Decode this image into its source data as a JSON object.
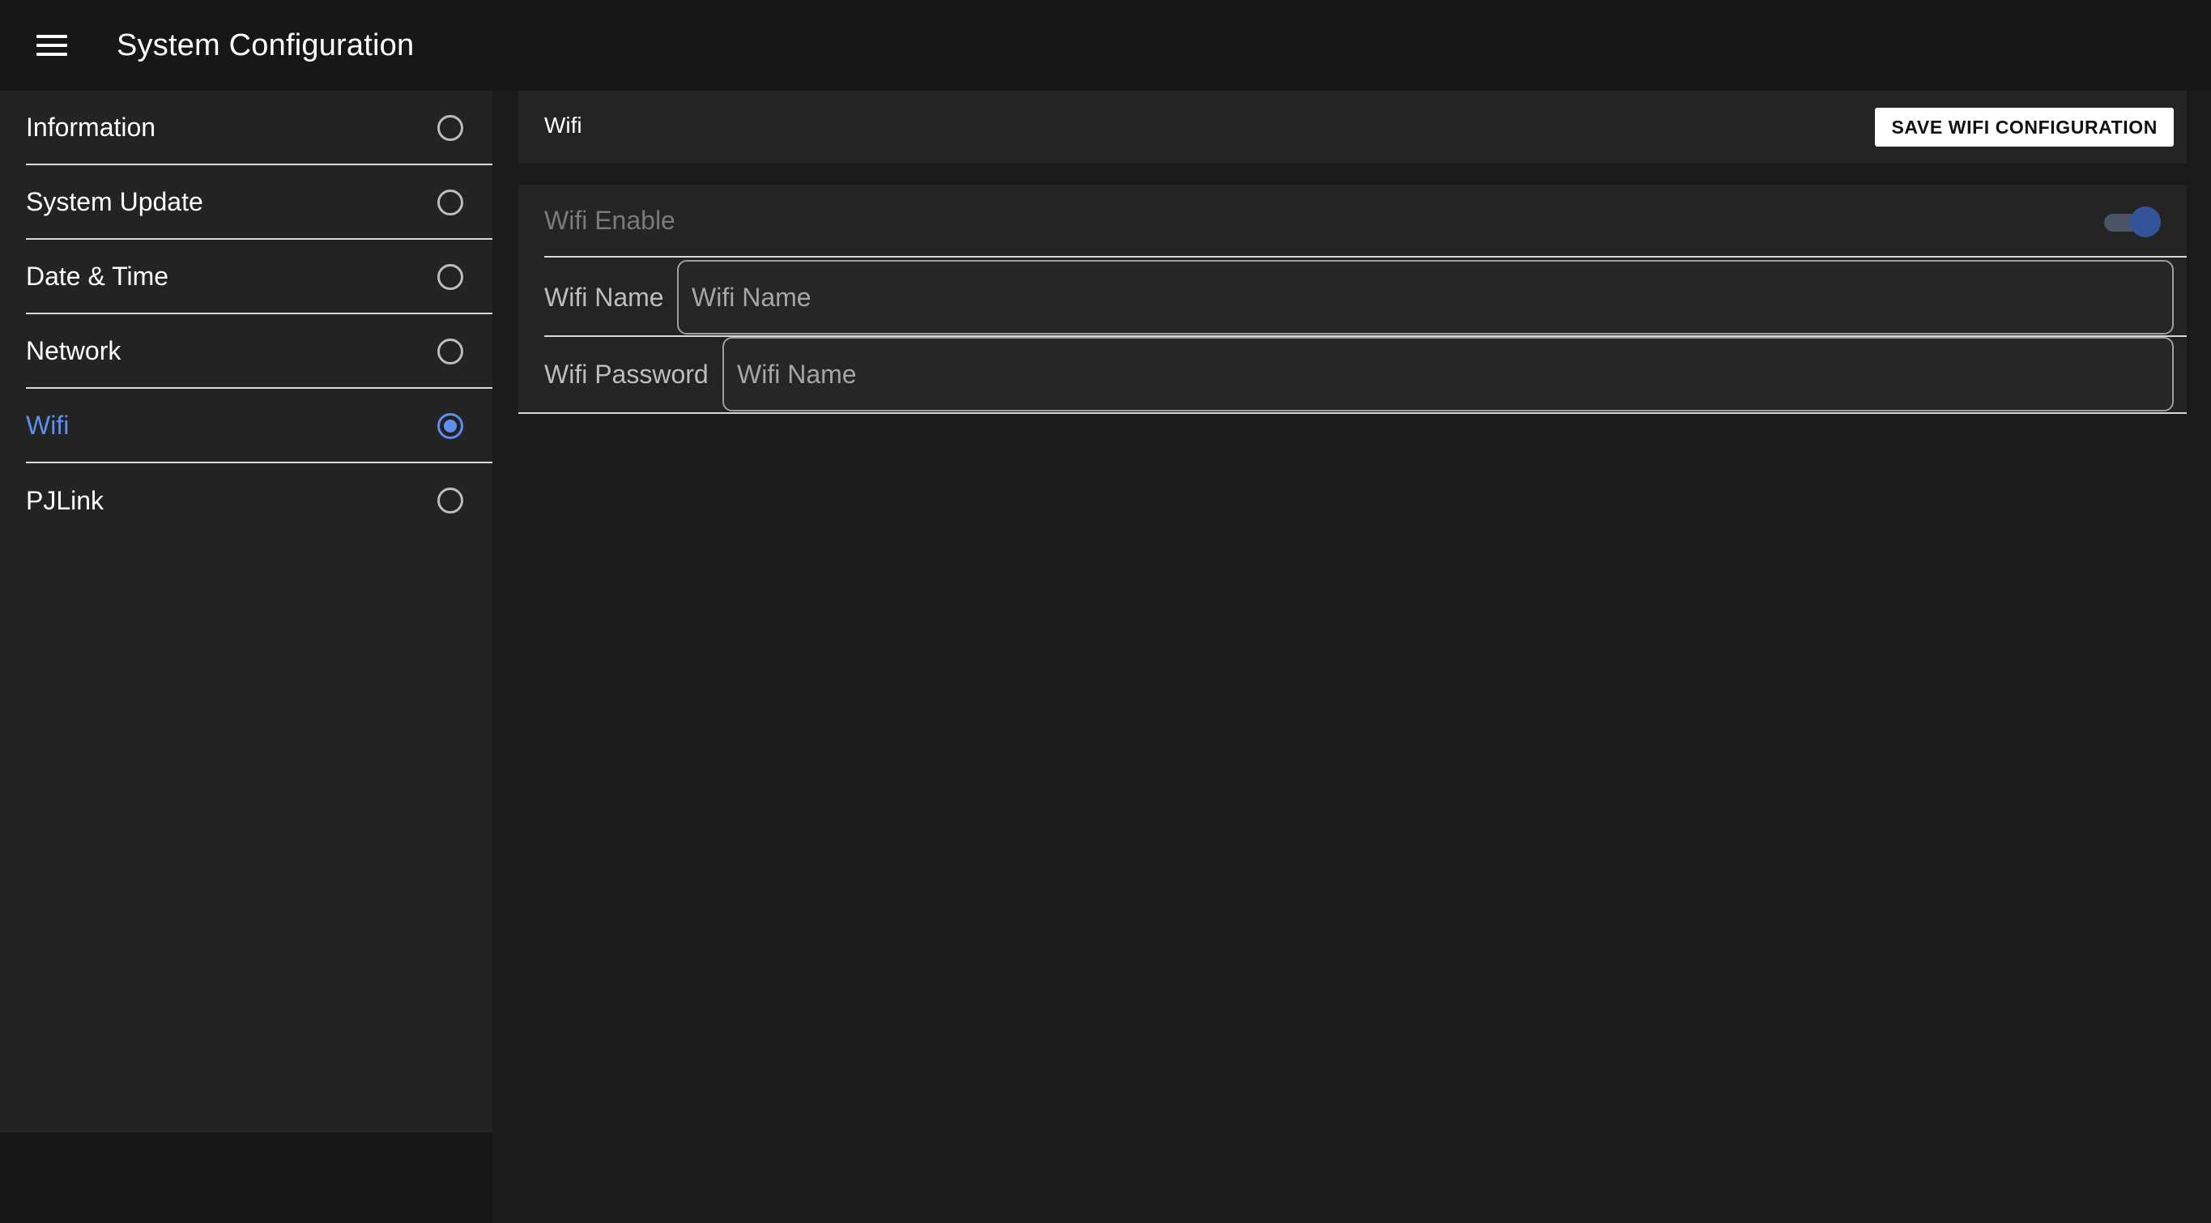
{
  "appbar": {
    "title": "System Configuration",
    "menu_icon": "hamburger-menu-icon"
  },
  "sidebar": {
    "items": [
      {
        "label": "Information",
        "selected": false
      },
      {
        "label": "System Update",
        "selected": false
      },
      {
        "label": "Date & Time",
        "selected": false
      },
      {
        "label": "Network",
        "selected": false
      },
      {
        "label": "Wifi",
        "selected": true
      },
      {
        "label": "PJLink",
        "selected": false
      }
    ],
    "accent_color": "#5c8ff0"
  },
  "section": {
    "title": "Wifi",
    "save_label": "SAVE WIFI CONFIGURATION"
  },
  "form": {
    "enable_label": "Wifi Enable",
    "enable_on": true,
    "name_label": "Wifi Name",
    "name_placeholder": "Wifi Name",
    "name_value": "",
    "password_label": "Wifi Password",
    "password_placeholder": "Wifi Name",
    "password_value": ""
  }
}
